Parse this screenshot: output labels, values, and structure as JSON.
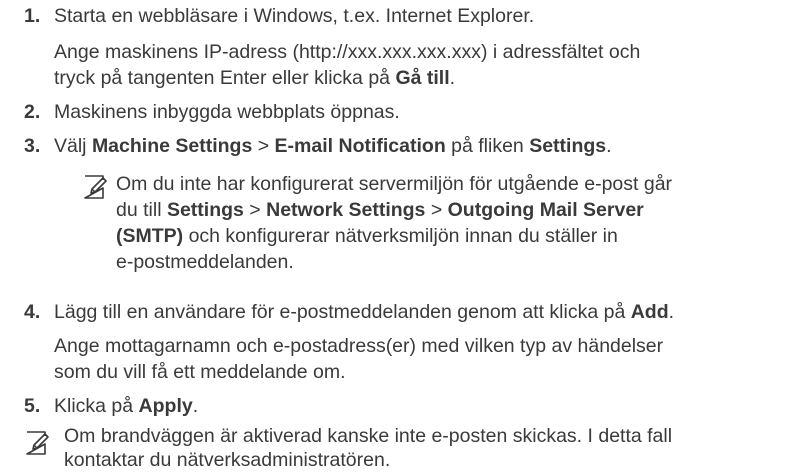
{
  "steps": [
    {
      "num": "1.",
      "lines": [
        {
          "parts": [
            {
              "t": "Starta en webbläsare i Windows, t.ex. Internet Explorer."
            }
          ]
        },
        {
          "parts": [
            {
              "t": "Ange maskinens IP-adress (http://xxx.xxx.xxx.xxx) i adressfältet och"
            }
          ]
        },
        {
          "parts": [
            {
              "t": "tryck på tangenten Enter eller klicka på "
            },
            {
              "t": "Gå till",
              "b": true
            },
            {
              "t": "."
            }
          ]
        }
      ]
    },
    {
      "num": "2.",
      "lines": [
        {
          "parts": [
            {
              "t": "Maskinens inbyggda webbplats öppnas."
            }
          ]
        }
      ]
    },
    {
      "num": "3.",
      "lines": [
        {
          "parts": [
            {
              "t": "Välj "
            },
            {
              "t": "Machine Settings",
              "b": true
            },
            {
              "t": " > "
            },
            {
              "t": "E-mail Notification",
              "b": true
            },
            {
              "t": " på fliken "
            },
            {
              "t": "Settings",
              "b": true
            },
            {
              "t": "."
            }
          ]
        }
      ]
    },
    {
      "num": "4.",
      "lines": [
        {
          "parts": [
            {
              "t": "Lägg till en användare för e-postmeddelanden genom att klicka på "
            },
            {
              "t": "Add",
              "b": true
            },
            {
              "t": "."
            }
          ]
        },
        {
          "parts": [
            {
              "t": "Ange mottagarnamn och e-postadress(er) med vilken typ av händelser"
            }
          ]
        },
        {
          "parts": [
            {
              "t": "som du vill få ett meddelande om."
            }
          ]
        }
      ]
    },
    {
      "num": "5.",
      "lines": [
        {
          "parts": [
            {
              "t": "Klicka på "
            },
            {
              "t": "Apply",
              "b": true
            },
            {
              "t": "."
            }
          ]
        }
      ]
    }
  ],
  "note1": {
    "icon": "note-pencil-icon",
    "lines": [
      {
        "parts": [
          {
            "t": "Om du inte har konfigurerat servermiljön för utgående e-post går"
          }
        ]
      },
      {
        "parts": [
          {
            "t": "du till "
          },
          {
            "t": "Settings",
            "b": true
          },
          {
            "t": " > "
          },
          {
            "t": "Network Settings",
            "b": true
          },
          {
            "t": " > "
          },
          {
            "t": "Outgoing Mail Server",
            "b": true
          }
        ]
      },
      {
        "parts": [
          {
            "t": "(SMTP)",
            "b": true
          },
          {
            "t": " och konfigurerar nätverksmiljön innan du ställer in"
          }
        ]
      },
      {
        "parts": [
          {
            "t": "e-postmeddelanden."
          }
        ]
      }
    ]
  },
  "note2": {
    "icon": "note-pencil-icon",
    "lines": [
      {
        "parts": [
          {
            "t": "Om brandväggen är aktiverad kanske inte e-posten skickas. I detta fall"
          }
        ]
      },
      {
        "parts": [
          {
            "t": "kontaktar du nätverksadministratören."
          }
        ]
      }
    ]
  }
}
